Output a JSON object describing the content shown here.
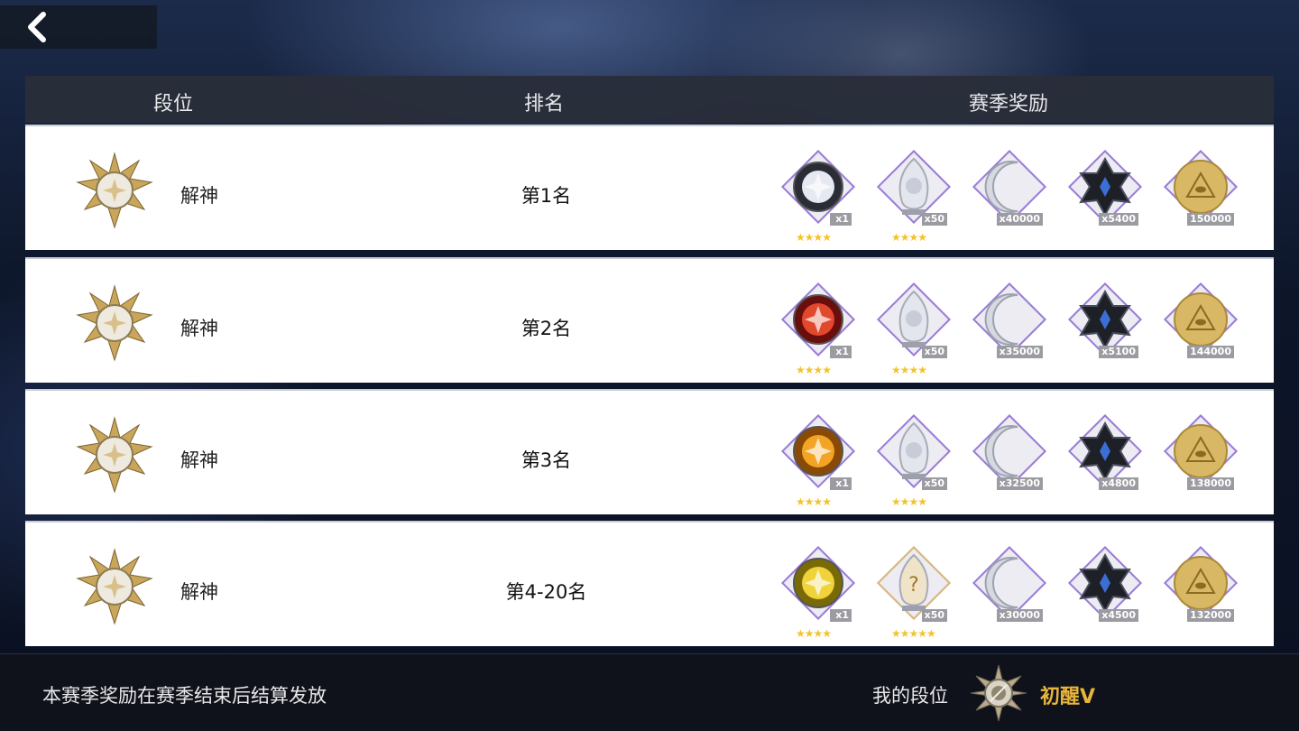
{
  "header": {
    "back_icon": "chevron-left-icon"
  },
  "table": {
    "columns": [
      "段位",
      "排名",
      "赛季奖励"
    ],
    "rows": [
      {
        "tier": "解神",
        "place": "第1名",
        "rewards": [
          {
            "icon": "silver-rune-badge-icon",
            "qty": "x1",
            "stars": "★★★★"
          },
          {
            "icon": "crystal-character-shard-icon",
            "qty": "x50",
            "stars": "★★★★"
          },
          {
            "icon": "crescent-moon-icon",
            "qty": "x40000",
            "stars": ""
          },
          {
            "icon": "dark-crystal-icon",
            "qty": "x5400",
            "stars": ""
          },
          {
            "icon": "gold-eye-coin-icon",
            "qty": "150000",
            "stars": ""
          }
        ]
      },
      {
        "tier": "解神",
        "place": "第2名",
        "rewards": [
          {
            "icon": "red-rune-badge-icon",
            "qty": "x1",
            "stars": "★★★★"
          },
          {
            "icon": "crystal-character-shard-icon",
            "qty": "x50",
            "stars": "★★★★"
          },
          {
            "icon": "crescent-moon-icon",
            "qty": "x35000",
            "stars": ""
          },
          {
            "icon": "dark-crystal-icon",
            "qty": "x5100",
            "stars": ""
          },
          {
            "icon": "gold-eye-coin-icon",
            "qty": "144000",
            "stars": ""
          }
        ]
      },
      {
        "tier": "解神",
        "place": "第3名",
        "rewards": [
          {
            "icon": "orange-rune-badge-icon",
            "qty": "x1",
            "stars": "★★★★"
          },
          {
            "icon": "crystal-character-shard-icon",
            "qty": "x50",
            "stars": "★★★★"
          },
          {
            "icon": "crescent-moon-icon",
            "qty": "x32500",
            "stars": ""
          },
          {
            "icon": "dark-crystal-icon",
            "qty": "x4800",
            "stars": ""
          },
          {
            "icon": "gold-eye-coin-icon",
            "qty": "138000",
            "stars": ""
          }
        ]
      },
      {
        "tier": "解神",
        "place": "第4-20名",
        "rewards": [
          {
            "icon": "yellow-rune-badge-icon",
            "qty": "x1",
            "stars": "★★★★"
          },
          {
            "icon": "mystery-crystal-shard-icon",
            "qty": "x50",
            "stars": "★★★★★"
          },
          {
            "icon": "crescent-moon-icon",
            "qty": "x30000",
            "stars": ""
          },
          {
            "icon": "dark-crystal-icon",
            "qty": "x4500",
            "stars": ""
          },
          {
            "icon": "gold-eye-coin-icon",
            "qty": "132000",
            "stars": ""
          }
        ]
      }
    ]
  },
  "footer": {
    "note": "本赛季奖励在赛季结束后结算发放",
    "my_tier_label": "我的段位",
    "my_tier": "初醒V"
  },
  "colors": {
    "tier_gold": "#e8b53c",
    "frame_purple": "#9a7bd8",
    "frame_gold": "#d7b47a",
    "star_yellow": "#f3c32c"
  }
}
